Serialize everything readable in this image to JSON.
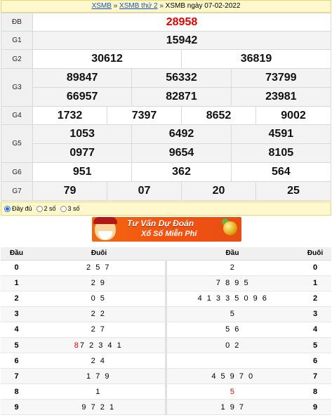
{
  "breadcrumb": {
    "link1": "XSMB",
    "sep1": "»",
    "link2": "XSMB thứ 2",
    "sep2": "»",
    "current": "XSMB ngày 07-02-2022"
  },
  "results": {
    "labels": {
      "db": "ĐB",
      "g1": "G1",
      "g2": "G2",
      "g3": "G3",
      "g4": "G4",
      "g5": "G5",
      "g6": "G6",
      "g7": "G7"
    },
    "db": "28958",
    "g1": "15942",
    "g2": [
      "30612",
      "36819"
    ],
    "g3": [
      "89847",
      "56332",
      "73799",
      "66957",
      "82871",
      "23981"
    ],
    "g4": [
      "1732",
      "7397",
      "8652",
      "9002"
    ],
    "g5": [
      "1053",
      "6492",
      "4591",
      "0977",
      "9654",
      "8105"
    ],
    "g6": [
      "951",
      "362",
      "564"
    ],
    "g7": [
      "79",
      "07",
      "20",
      "25"
    ]
  },
  "options": {
    "full": "Đầy đủ",
    "two": "2 số",
    "three": "3 số",
    "selected": "full"
  },
  "banner": {
    "line1": "Tư Vấn Dự Đoán",
    "line2": "Xổ Số Miễn Phí"
  },
  "loto": {
    "headers": {
      "dau": "Đầu",
      "duoi": "Đuôi",
      "dau2": "Đầu",
      "duoi2": "Đuôi"
    },
    "rows": [
      {
        "k": "0",
        "tail": "2 5 7",
        "head": "2",
        "k2": "0"
      },
      {
        "k": "1",
        "tail": "2 9",
        "head": "7 8 9 5",
        "k2": "1"
      },
      {
        "k": "2",
        "tail": "0 5",
        "head": "4 1 3 3 5 0 9 6",
        "k2": "2"
      },
      {
        "k": "3",
        "tail": "2 2",
        "head": "5",
        "k2": "3"
      },
      {
        "k": "4",
        "tail": "2 7",
        "head": "5 6",
        "k2": "4"
      },
      {
        "k": "5",
        "tail_red": "8",
        "tail": "7 2 3 4 1",
        "head": "0 2",
        "k2": "5"
      },
      {
        "k": "6",
        "tail": "2 4",
        "head": "",
        "k2": "6"
      },
      {
        "k": "7",
        "tail": "1 7 9",
        "head": "4 5 9 7 0",
        "k2": "7"
      },
      {
        "k": "8",
        "tail": "1",
        "head_red": "5",
        "head": "",
        "k2": "8"
      },
      {
        "k": "9",
        "tail": "9 7 2 1",
        "head": "1 9 7",
        "k2": "9"
      }
    ]
  }
}
